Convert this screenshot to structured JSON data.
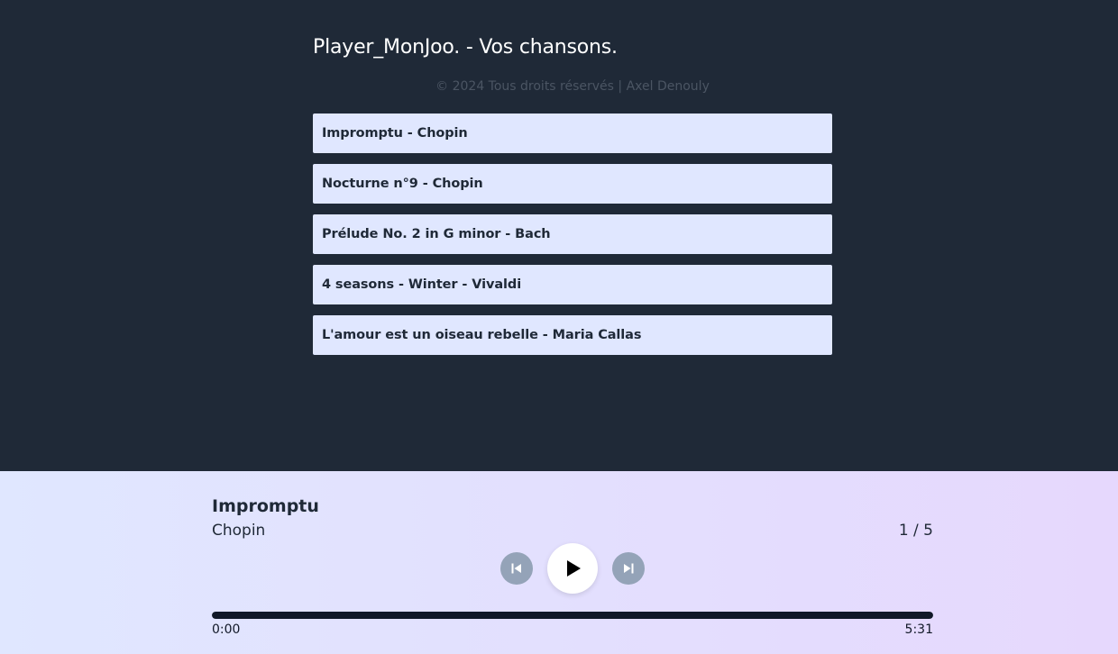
{
  "header": {
    "title": "Player_MonJoo. - Vos chansons.",
    "copyright": "© 2024 Tous droits réservés | Axel Denouly"
  },
  "songs": [
    {
      "label": "Impromptu - Chopin"
    },
    {
      "label": "Nocturne n°9 - Chopin"
    },
    {
      "label": "Prélude No. 2 in G minor - Bach"
    },
    {
      "label": "4 seasons - Winter - Vivaldi"
    },
    {
      "label": "L'amour est un oiseau rebelle - Maria Callas"
    }
  ],
  "player": {
    "title": "Impromptu",
    "artist": "Chopin",
    "track_counter": "1 / 5",
    "current_time": "0:00",
    "total_time": "5:31",
    "progress": 1.0,
    "icons": {
      "previous": "skip-previous-icon",
      "play": "play-icon",
      "next": "skip-next-icon"
    }
  },
  "colors": {
    "background_dark": "#1f2937",
    "list_item_bg": "#e0e7ff",
    "player_gradient_start": "#e0e7ff",
    "player_gradient_end": "#e6d8fd",
    "control_muted": "#94a3b8",
    "progress_fill": "#111827"
  }
}
